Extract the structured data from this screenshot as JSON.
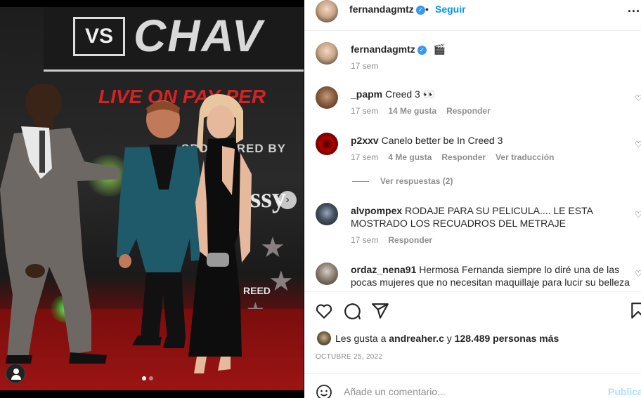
{
  "photo": {
    "banner_vs": "VS",
    "banner_name": "CHAV",
    "banner_live": "LIVE ON PAY PER",
    "banner_sponsored": "SPONSORED BY",
    "banner_brand": "essy",
    "banner_reed": "REED",
    "carousel_dots": 2,
    "carousel_active": 0
  },
  "header": {
    "username": "fernandagmtz",
    "bullet": "•",
    "follow_label": "Seguir",
    "more_label": "..."
  },
  "caption": {
    "username": "fernandagmtz",
    "emoji": "🎬",
    "time": "17 sem"
  },
  "comments": [
    {
      "username": "_papm",
      "text": "Creed 3 👀",
      "time": "17 sem",
      "likes": "14 Me gusta",
      "reply": "Responder",
      "translate": ""
    },
    {
      "username": "p2xxv",
      "text": "Canelo better be In Creed 3",
      "time": "17 sem",
      "likes": "4 Me gusta",
      "reply": "Responder",
      "translate": "Ver traducción"
    },
    {
      "username": "alvpompex",
      "text": "RODAJE PARA SU PELICULA.... LE ESTA MOSTRADO LOS RECUADROS DEL METRAJE",
      "time": "17 sem",
      "likes": "",
      "reply": "Responder",
      "translate": ""
    },
    {
      "username": "ordaz_nena91",
      "text": "Hermosa Fernanda siempre lo diré una de las pocas mujeres que no necesitan maquillaje para lucir su belleza",
      "time": "",
      "likes": "",
      "reply": "",
      "translate": ""
    }
  ],
  "view_replies": "Ver respuestas (2)",
  "likes": {
    "prefix": "Les gusta a",
    "user": "andreaher.c",
    "conj": "y",
    "count": "128.489 personas más"
  },
  "date": "OCTUBRE 25, 2022",
  "add_comment": {
    "placeholder": "Añade un comentario...",
    "publish": "Publicar"
  },
  "icons": [
    "heart-icon",
    "comment-icon",
    "share-icon",
    "bookmark-icon",
    "emoji-icon",
    "tag-user-icon",
    "next-arrow-icon",
    "verified-icon",
    "more-icon"
  ]
}
